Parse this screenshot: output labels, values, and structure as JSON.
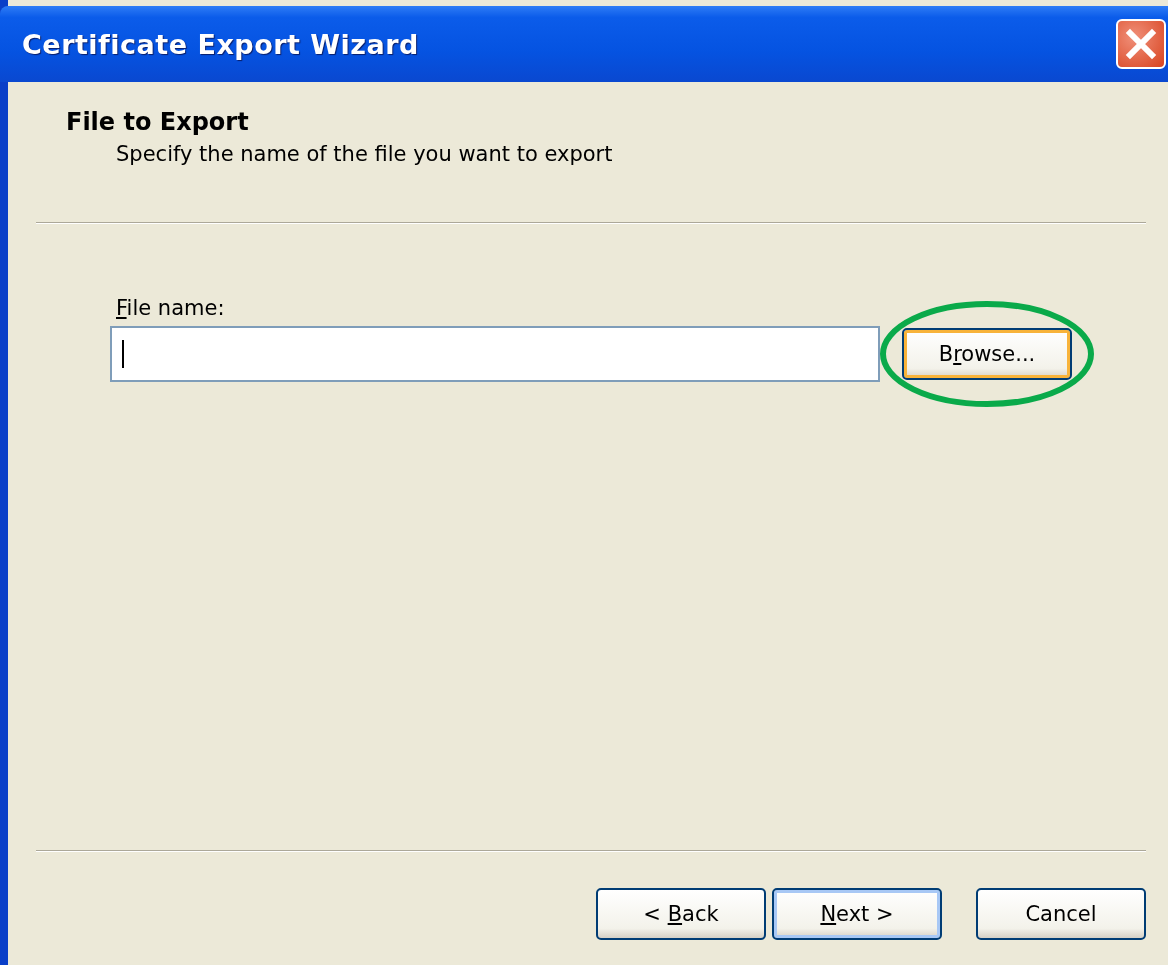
{
  "window": {
    "title": "Certificate Export Wizard"
  },
  "header": {
    "title": "File to Export",
    "subtitle": "Specify the name of the file you want to export"
  },
  "file_field": {
    "label": {
      "key": "F",
      "after": "ile name:"
    },
    "focused": true
  },
  "browse_button": {
    "label": {
      "before": "B",
      "key": "r",
      "after": "owse..."
    },
    "circled": true,
    "hovered": true
  },
  "buttons": [
    {
      "label": {
        "before": "< ",
        "key": "B",
        "after": "ack"
      },
      "default": false
    },
    {
      "label": {
        "key": "N",
        "after": "ext >"
      },
      "default": true
    },
    {
      "label": {
        "after": "Cancel"
      },
      "default": false
    }
  ]
}
